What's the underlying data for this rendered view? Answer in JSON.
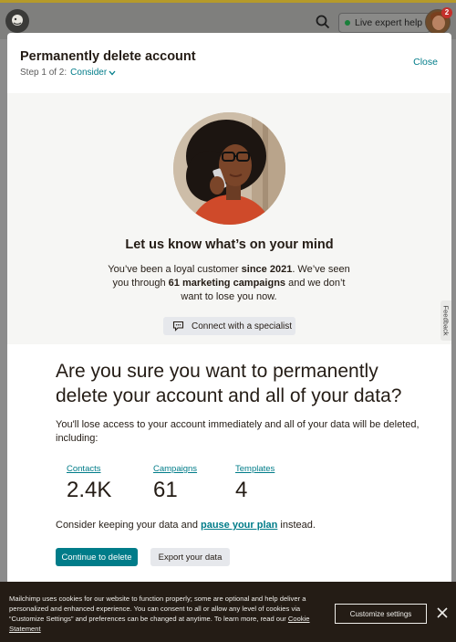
{
  "topbar": {
    "live_help_label": "Live expert help",
    "notification_count": "2",
    "icons": [
      "mailchimp-logo",
      "search-icon",
      "status-dot",
      "avatar"
    ]
  },
  "modal": {
    "title": "Permanently delete account",
    "step_prefix": "Step 1 of 2:",
    "step_dropdown": "Consider",
    "close_label": "Close"
  },
  "panel": {
    "heading": "Let us know what’s on your mind",
    "text_1": "You’ve been a loyal customer ",
    "since": "since 2021",
    "text_2": ". We’ve seen you through ",
    "campaigns_bold": "61 marketing campaigns",
    "text_3": " and we don’t want to lose you now.",
    "specialist_label": "Connect with a specialist"
  },
  "feedback_label": "Feedback",
  "confirm": {
    "question": "Are you sure you want to permanently delete your account and all of your data?",
    "lose_text": "You'll lose access to your account immediately and all of your data will be deleted, including:",
    "stats": [
      {
        "label": "Contacts",
        "value": "2.4K"
      },
      {
        "label": "Campaigns",
        "value": "61"
      },
      {
        "label": "Templates",
        "value": "4"
      }
    ],
    "consider_prefix": "Consider keeping your data and ",
    "consider_link": "pause your plan",
    "consider_suffix": " instead.",
    "continue_label": "Continue to delete",
    "export_label": "Export your data"
  },
  "cookie": {
    "text": "Mailchimp uses cookies for our website to function properly; some are optional and help deliver a personalized and enhanced experience. You can consent to all or allow any level of cookies via “Customize Settings” and preferences can be changed at anytime. To learn more, read our ",
    "link": "Cookie Statement",
    "settings_label": "Customize settings"
  },
  "colors": {
    "accent": "#007c89",
    "text": "#241c15",
    "cookie_bg": "#241c15",
    "panel_bg": "#f6f6f4"
  }
}
